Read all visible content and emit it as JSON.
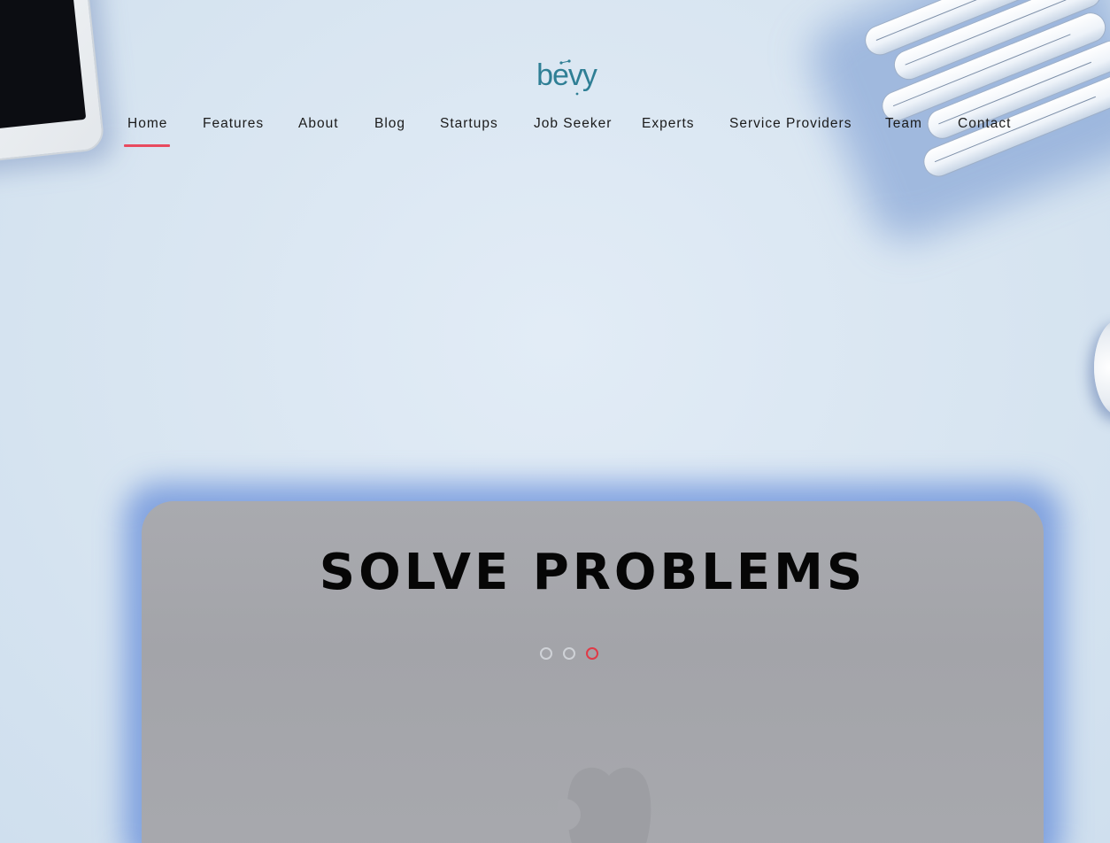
{
  "brand": {
    "name": "bevy",
    "color": "#2f7f95"
  },
  "nav": {
    "items": [
      {
        "label": "Home",
        "active": true
      },
      {
        "label": "Features",
        "active": false
      },
      {
        "label": "About",
        "active": false
      },
      {
        "label": "Blog",
        "active": false
      },
      {
        "label": "Startups",
        "active": false
      },
      {
        "label": "Job Seeker",
        "active": false
      },
      {
        "label": "Experts",
        "active": false
      },
      {
        "label": "Service Providers",
        "active": false
      },
      {
        "label": "Team",
        "active": false
      },
      {
        "label": "Contact",
        "active": false
      }
    ],
    "active_color": "#e84a5f"
  },
  "hero": {
    "title": "SOLVE PROBLEMS",
    "slides": 3,
    "active_slide": 3,
    "dot_active_color": "#e03a47"
  },
  "icons": {
    "logo": "bevy-logo",
    "laptop_brand": "apple-logo-icon"
  }
}
